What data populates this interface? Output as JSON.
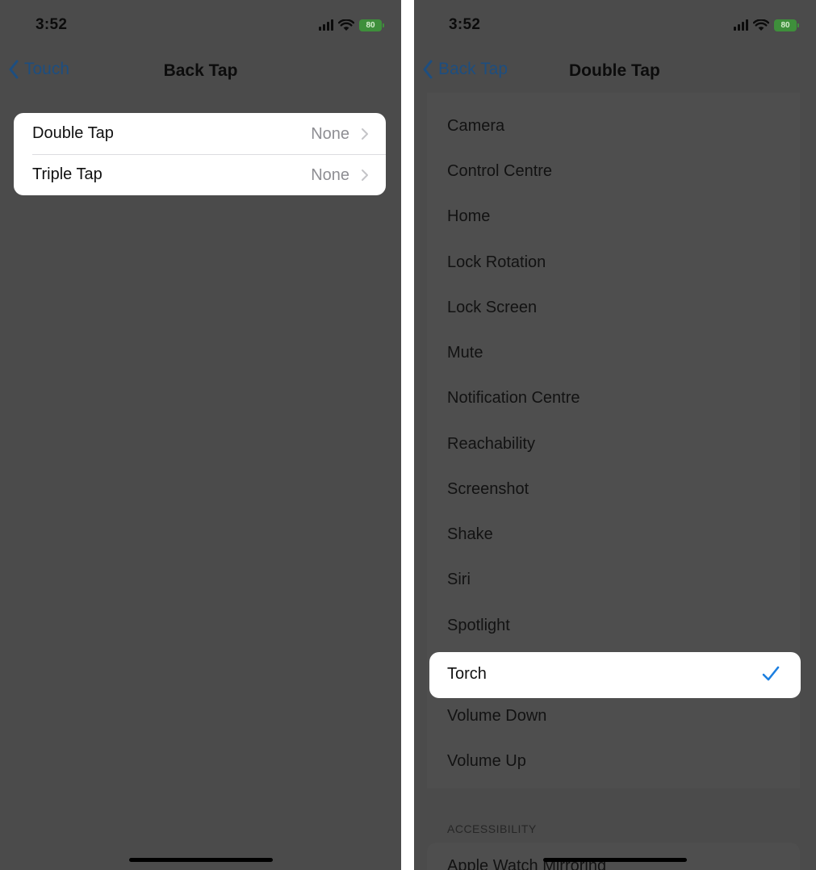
{
  "left": {
    "status": {
      "time": "3:52",
      "battery": "80"
    },
    "nav": {
      "back_label": "Touch",
      "title": "Back Tap"
    },
    "rows": [
      {
        "label": "Double Tap",
        "value": "None"
      },
      {
        "label": "Triple Tap",
        "value": "None"
      }
    ]
  },
  "right": {
    "status": {
      "time": "3:52",
      "battery": "80"
    },
    "nav": {
      "back_label": "Back Tap",
      "title": "Double Tap"
    },
    "options": [
      "Camera",
      "Control Centre",
      "Home",
      "Lock Rotation",
      "Lock Screen",
      "Mute",
      "Notification Centre",
      "Reachability",
      "Screenshot",
      "Shake",
      "Siri",
      "Spotlight",
      "Torch",
      "Volume Down",
      "Volume Up"
    ],
    "selected": "Torch",
    "section_header": "ACCESSIBILITY",
    "accessibility_first": "Apple Watch Mirroring"
  },
  "colors": {
    "accent": "#1d4e80",
    "check": "#1c7fe0",
    "dim_background": "#4b4b4b",
    "battery": "#3e8f3b"
  },
  "icons": {
    "back": "chevron-left-icon",
    "disclosure": "chevron-right-icon",
    "selected": "checkmark-icon",
    "signal": "cellular-signal-icon",
    "wifi": "wifi-icon",
    "battery": "battery-icon"
  }
}
